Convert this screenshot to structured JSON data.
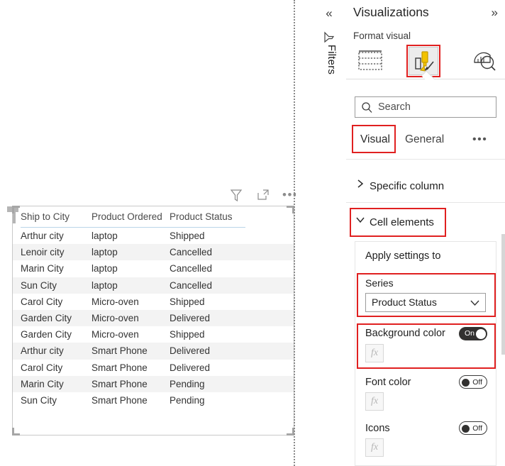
{
  "canvas": {
    "visual_toolbar": {
      "filter_icon": "filter-icon",
      "focus_icon": "focus-mode-icon",
      "more_label": "•••"
    },
    "table": {
      "columns": [
        "Ship to City",
        "Product Ordered",
        "Product Status"
      ],
      "rows": [
        [
          "Arthur city",
          "laptop",
          "Shipped"
        ],
        [
          "Lenoir city",
          "laptop",
          "Cancelled"
        ],
        [
          "Marin City",
          "laptop",
          "Cancelled"
        ],
        [
          "Sun City",
          "laptop",
          "Cancelled"
        ],
        [
          "Carol City",
          "Micro-oven",
          "Shipped"
        ],
        [
          "Garden City",
          "Micro-oven",
          "Delivered"
        ],
        [
          "Garden City",
          "Micro-oven",
          "Shipped"
        ],
        [
          "Arthur city",
          "Smart Phone",
          "Delivered"
        ],
        [
          "Carol City",
          "Smart Phone",
          "Delivered"
        ],
        [
          "Marin City",
          "Smart Phone",
          "Pending"
        ],
        [
          "Sun City",
          "Smart Phone",
          "Pending"
        ]
      ]
    }
  },
  "filters_rail": {
    "collapse_glyph": "«",
    "filter_icon": "filter-outline-icon",
    "label": "Filters"
  },
  "panel": {
    "title": "Visualizations",
    "expand_glyph": "»",
    "subtitle": "Format visual",
    "icons": [
      {
        "name": "build-visual-icon",
        "label": "Build visual"
      },
      {
        "name": "format-visual-icon",
        "label": "Format visual"
      },
      {
        "name": "analytics-icon",
        "label": "Analytics"
      }
    ],
    "search": {
      "placeholder": "Search",
      "value": "",
      "icon": "search-icon"
    },
    "tabs": [
      {
        "label": "Visual",
        "selected": true
      },
      {
        "label": "General",
        "selected": false
      }
    ],
    "tab_more": "•••",
    "sections": [
      {
        "label": "Specific column",
        "expanded": false,
        "chevron": "chevron-right-icon"
      },
      {
        "label": "Cell elements",
        "expanded": true,
        "chevron": "chevron-down-icon"
      }
    ],
    "cell_elements": {
      "apply_settings_label": "Apply settings to",
      "series": {
        "label": "Series",
        "value": "Product Status",
        "chevron": "chevron-down-icon"
      },
      "properties": [
        {
          "label": "Background color",
          "state": "On",
          "fx": "fx"
        },
        {
          "label": "Font color",
          "state": "Off",
          "fx": "fx"
        },
        {
          "label": "Icons",
          "state": "Off",
          "fx": "fx"
        }
      ]
    }
  },
  "colors": {
    "annotation_red": "#e02020",
    "toggle_on": "#323130",
    "band": "#f3f3f3",
    "header_rule": "#b9d4e8"
  }
}
